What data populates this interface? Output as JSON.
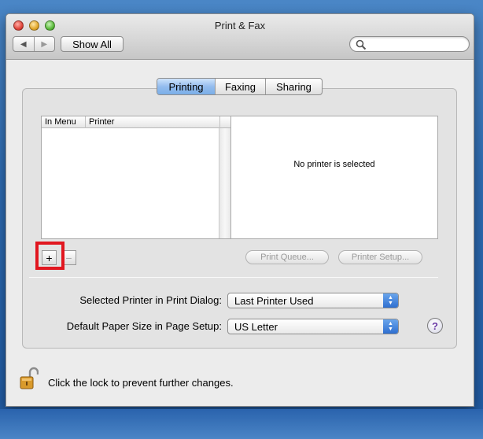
{
  "window": {
    "title": "Print & Fax",
    "nav": {
      "back_glyph": "◀",
      "forward_glyph": "▶"
    },
    "show_all_label": "Show All",
    "search": {
      "placeholder": "",
      "icon": "search-icon"
    }
  },
  "tabs": [
    {
      "label": "Printing",
      "active": true
    },
    {
      "label": "Faxing",
      "active": false
    },
    {
      "label": "Sharing",
      "active": false
    }
  ],
  "printer_list": {
    "columns": [
      "In Menu",
      "Printer"
    ],
    "rows": []
  },
  "details": {
    "empty_message": "No printer is selected"
  },
  "list_buttons": {
    "add_glyph": "+",
    "remove_glyph": "−"
  },
  "actions": {
    "print_queue_label": "Print Queue...",
    "printer_setup_label": "Printer Setup..."
  },
  "settings": {
    "selected_printer_label": "Selected Printer in Print Dialog:",
    "selected_printer_value": "Last Printer Used",
    "paper_size_label": "Default Paper Size in Page Setup:",
    "paper_size_value": "US Letter"
  },
  "help_glyph": "?",
  "lock": {
    "text": "Click the lock to prevent further changes.",
    "icon": "lock-open-icon"
  },
  "colors": {
    "selected_tab": "#94bdee",
    "highlight_box": "#e1161f",
    "popup_arrows": "#2f6fd0"
  }
}
